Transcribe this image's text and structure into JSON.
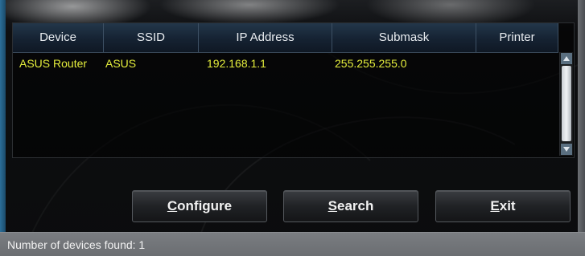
{
  "table": {
    "columns": [
      "Device",
      "SSID",
      "IP Address",
      "Submask",
      "Printer"
    ],
    "rows": [
      {
        "device": "ASUS Router",
        "ssid": "ASUS",
        "ip": "192.168.1.1",
        "submask": "255.255.255.0",
        "printer": ""
      }
    ]
  },
  "buttons": {
    "configure": {
      "mnemonic": "C",
      "rest": "onfigure"
    },
    "search": {
      "mnemonic": "S",
      "rest": "earch"
    },
    "exit": {
      "mnemonic": "E",
      "rest": "xit"
    }
  },
  "status": {
    "text": "Number of devices found: 1"
  },
  "colors": {
    "row_text": "#e5ee3c",
    "header_bg": "#152232",
    "status_bg": "#6e7175"
  }
}
